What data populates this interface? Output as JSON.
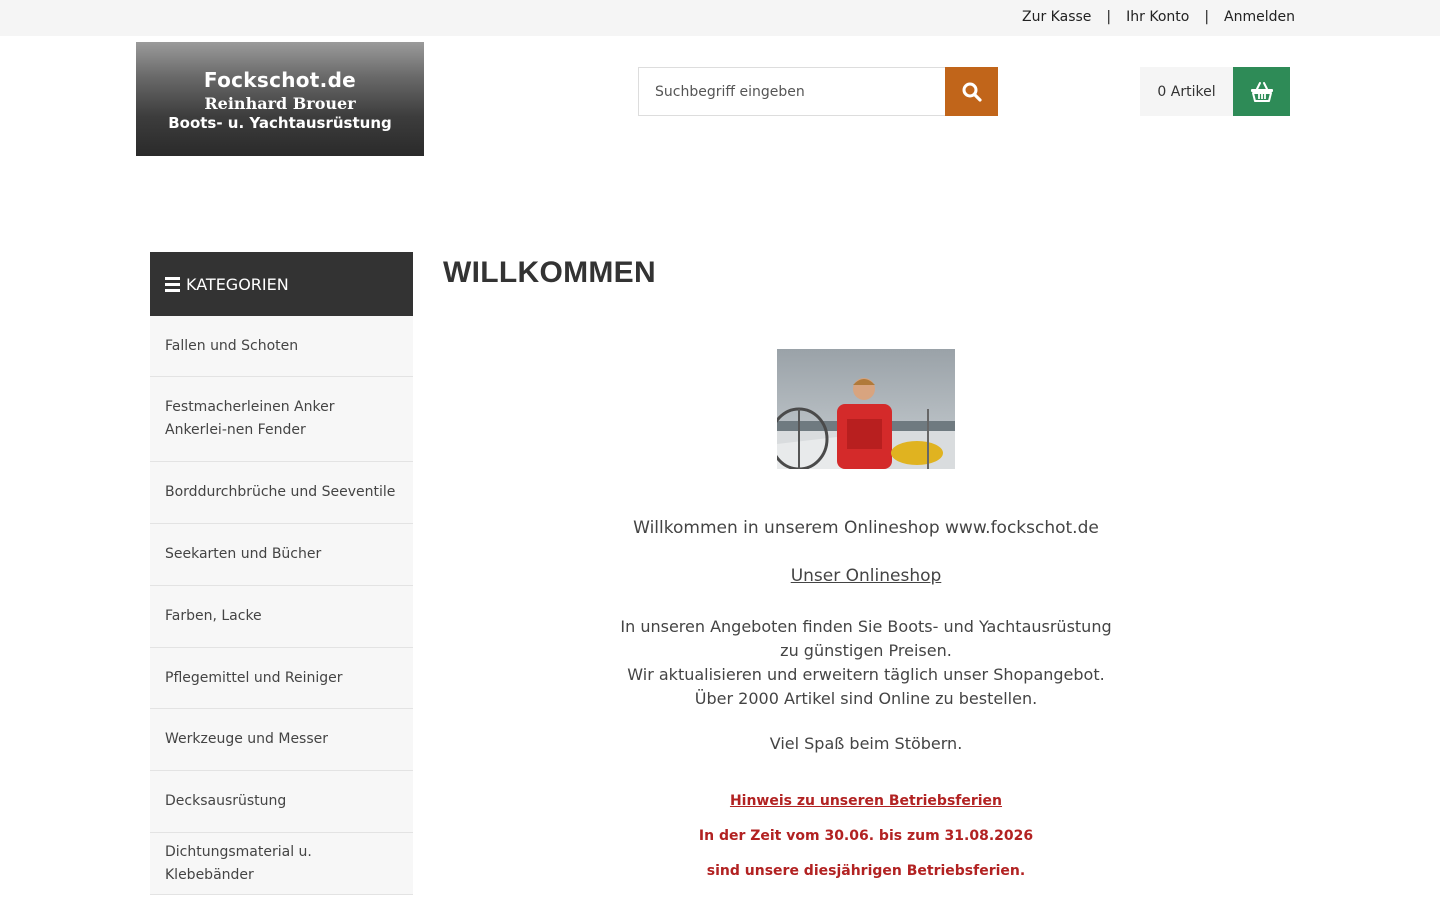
{
  "topnav": {
    "checkout": "Zur Kasse",
    "account": "Ihr Konto",
    "login": "Anmelden",
    "separator": "|"
  },
  "logo": {
    "line1": "Fockschot.de",
    "line2": "Reinhard Brouer",
    "line3": "Boots- u. Yachtausrüstung"
  },
  "search": {
    "placeholder": "Suchbegriff eingeben",
    "button_icon": "search-icon",
    "button_color": "#c1651a"
  },
  "cart": {
    "count_label": "0 Artikel",
    "icon": "basket-icon",
    "button_color": "#2e8b57"
  },
  "sidebar": {
    "heading": "KATEGORIEN",
    "heading_icon": "menu-icon",
    "items": [
      {
        "label": "Fallen und Schoten"
      },
      {
        "label": "Festmacherleinen Anker Ankerlei-nen Fender"
      },
      {
        "label": "Borddurchbrüche und Seeventile"
      },
      {
        "label": "Seekarten und Bücher"
      },
      {
        "label": "Farben, Lacke"
      },
      {
        "label": "Pflegemittel und Reiniger"
      },
      {
        "label": "Werkzeuge und Messer"
      },
      {
        "label": "Decksausrüstung"
      },
      {
        "label": "Dichtungsmaterial u. Klebebänder"
      }
    ]
  },
  "main": {
    "title": "WILLKOMMEN",
    "welcome": "Willkommen in unserem Onlineshop www.fockschot.de",
    "online_link": "Unser Onlineshop",
    "paragraph": [
      "In unseren Angeboten finden Sie Boots- und Yachtausrüstung",
      "zu günstigen Preisen.",
      "Wir aktualisieren und erweitern täglich unser Shopangebot.",
      "Über 2000 Artikel sind Online zu bestellen."
    ],
    "fun": "Viel Spaß beim Stöbern.",
    "notice_title": "Hinweis zu unseren Betriebsferien",
    "notice_line1": "In der Zeit vom 30.06. bis zum 31.08.2026",
    "notice_line2": "sind unsere diesjährigen Betriebsferien.",
    "notice_color": "#b22222"
  }
}
